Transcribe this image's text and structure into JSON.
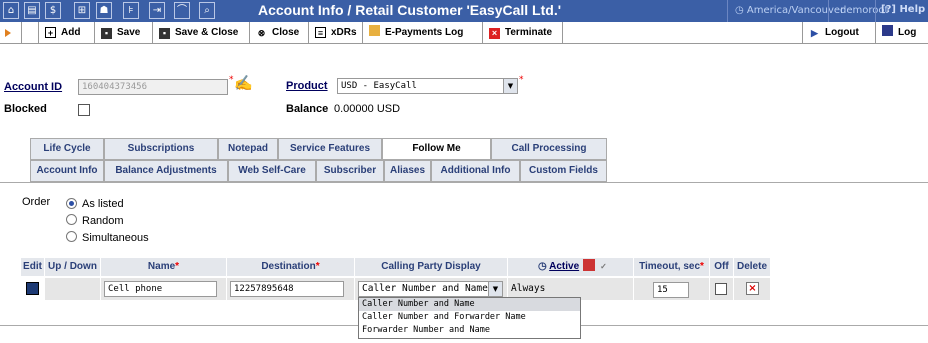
{
  "titlebar": {
    "title": "Account Info / Retail Customer 'EasyCall Ltd.'",
    "timezone": "America/Vancouver",
    "user": "demoroot",
    "help": "Help",
    "icons": [
      "home-icon",
      "grid-icon",
      "dollar-icon",
      "network-icon",
      "person-icon",
      "tree-icon",
      "trunk-icon",
      "chart-icon",
      "magnifier-icon"
    ]
  },
  "toolbar": {
    "add": "Add",
    "save": "Save",
    "save_close": "Save & Close",
    "close": "Close",
    "xdrs": "xDRs",
    "epayments": "E-Payments Log",
    "terminate": "Terminate",
    "logout": "Logout",
    "log": "Log"
  },
  "form": {
    "account_id_label": "Account ID",
    "account_id_value": "160404373456",
    "product_label": "Product",
    "product_value": "USD - EasyCall",
    "blocked_label": "Blocked",
    "balance_label": "Balance",
    "balance_value": "0.00000 USD"
  },
  "tabs": {
    "row1": [
      "Life Cycle",
      "Subscriptions",
      "Notepad",
      "Service Features",
      "Follow Me",
      "Call Processing"
    ],
    "row2": [
      "Account Info",
      "Balance Adjustments",
      "Web Self-Care",
      "Subscriber",
      "Aliases",
      "Additional Info",
      "Custom Fields"
    ],
    "active": "Follow Me"
  },
  "order": {
    "label": "Order",
    "options": [
      "As listed",
      "Random",
      "Simultaneous"
    ],
    "selected": "As listed"
  },
  "table": {
    "headers": {
      "edit": "Edit",
      "updown": "Up / Down",
      "name": "Name",
      "destination": "Destination",
      "cpd": "Calling Party Display",
      "active": "Active",
      "timeout": "Timeout, sec",
      "off": "Off",
      "delete": "Delete"
    },
    "row": {
      "name": "Cell phone",
      "destination": "12257895648",
      "cpd": "Caller Number and Name",
      "active": "Always",
      "timeout": "15"
    }
  },
  "cpd_options": [
    "Caller Number and Name",
    "Caller Number and Forwarder Name",
    "Forwarder Number and Name"
  ]
}
